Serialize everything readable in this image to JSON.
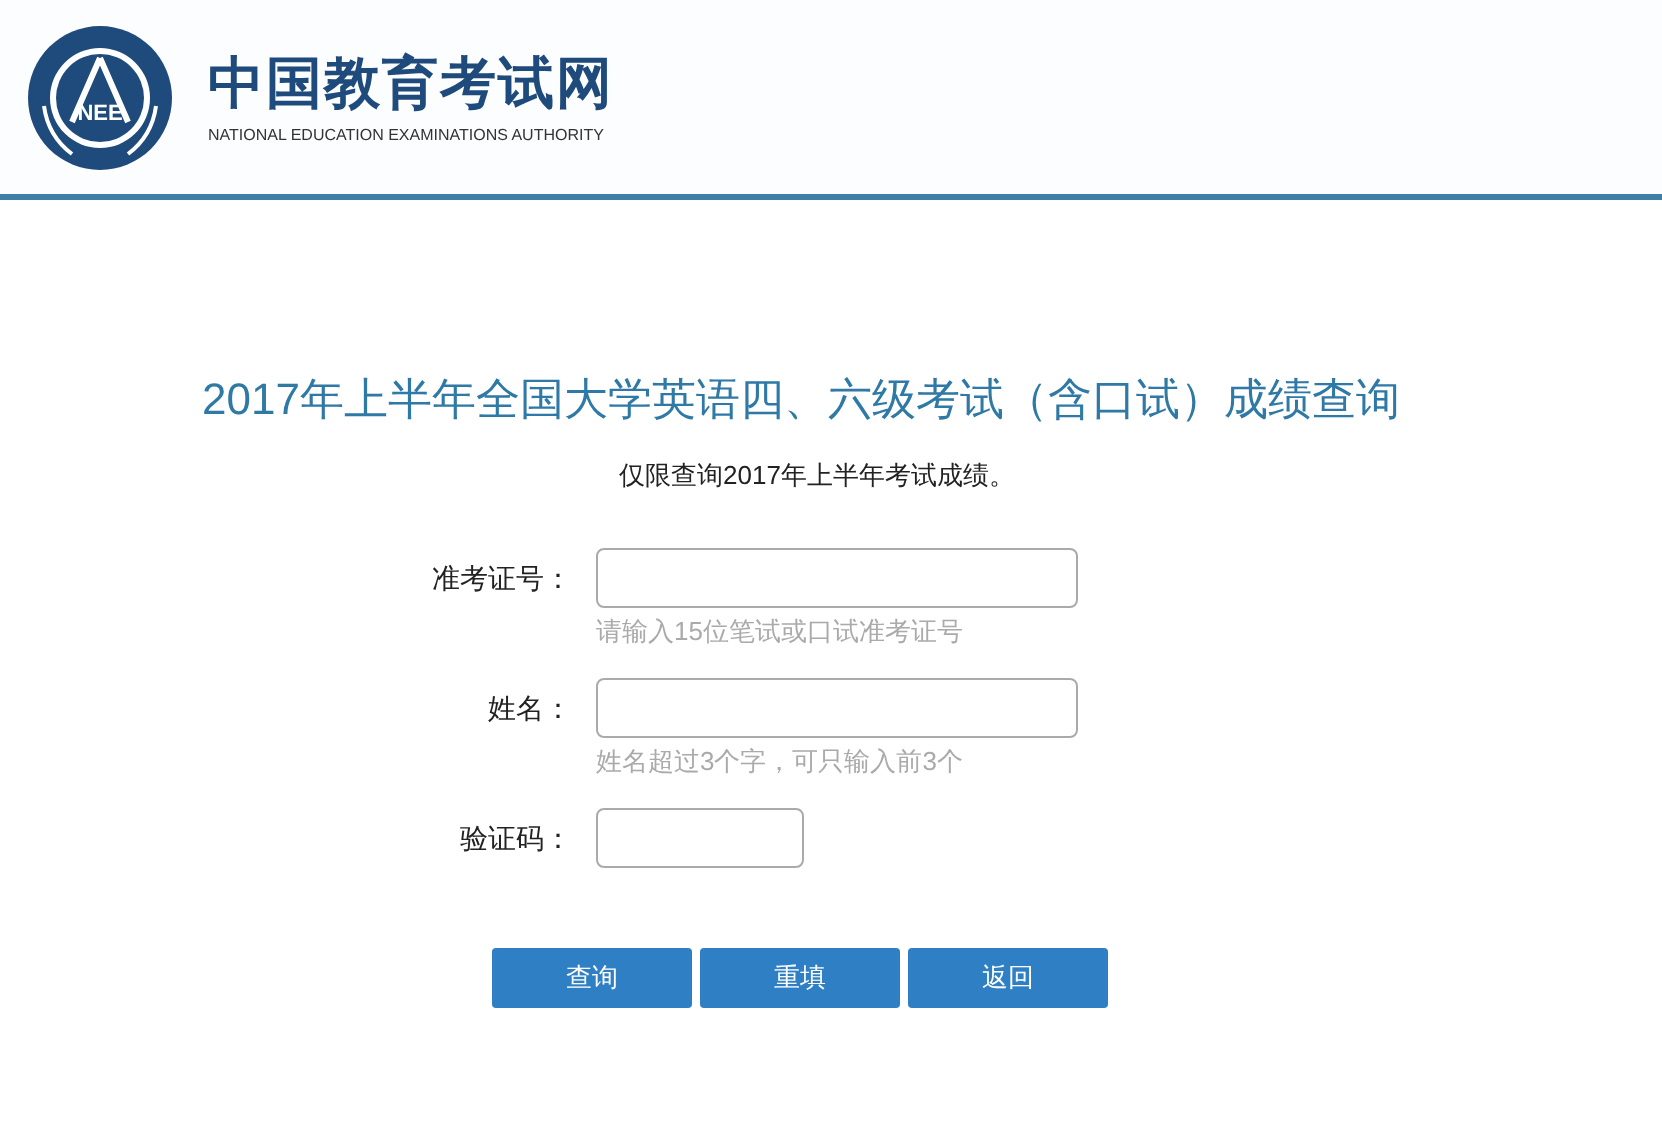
{
  "header": {
    "site_name": "中国教育考试网",
    "site_name_en": "NATIONAL EDUCATION EXAMINATIONS AUTHORITY",
    "logo_text": "NEE"
  },
  "title": "2017年上半年全国大学英语四、六级考试（含口试）成绩查询",
  "notice": "仅限查询2017年上半年考试成绩。",
  "fields": [
    {
      "label": "准考证号：",
      "hint": "请输入15位笔试或口试准考证号",
      "kind": "wide"
    },
    {
      "label": "姓名：",
      "hint": "姓名超过3个字，可只输入前3个",
      "kind": "wide"
    },
    {
      "label": "验证码：",
      "kind": "short"
    }
  ],
  "buttons": [
    "查询",
    "重填",
    "返回"
  ]
}
